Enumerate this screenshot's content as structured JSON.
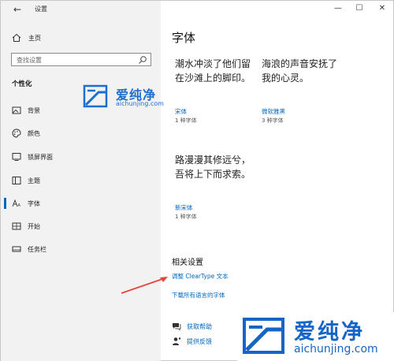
{
  "window": {
    "title": "设置"
  },
  "sidebar": {
    "home_label": "主页",
    "search_placeholder": "查找设置",
    "section_title": "个性化",
    "items": [
      {
        "label": "背景",
        "icon": "image-icon"
      },
      {
        "label": "颜色",
        "icon": "palette-icon"
      },
      {
        "label": "锁屏界面",
        "icon": "lock-screen-icon"
      },
      {
        "label": "主题",
        "icon": "theme-icon"
      },
      {
        "label": "字体",
        "icon": "font-icon",
        "active": true
      },
      {
        "label": "开始",
        "icon": "start-icon"
      },
      {
        "label": "任务栏",
        "icon": "taskbar-icon"
      }
    ]
  },
  "main": {
    "title": "字体",
    "fonts": [
      {
        "sample": "潮水冲淡了他们留在沙滩上的脚印。",
        "name": "宋体",
        "count": "1 种字体"
      },
      {
        "sample": "海浪的声音安抚了我的心灵。",
        "name": "微软雅黑",
        "count": "3 种字体"
      },
      {
        "sample": "路漫漫其修远兮，吾将上下而求索。",
        "name": "新宋体",
        "count": "1 种字体"
      }
    ],
    "related": {
      "title": "相关设置",
      "links": [
        "调整 ClearType 文本",
        "下载所有语言的字体"
      ]
    },
    "help": {
      "get_help": "获取帮助",
      "feedback": "提供反馈"
    }
  },
  "watermark": {
    "cn": "爱纯净",
    "en": "aichunjing.com"
  },
  "colors": {
    "accent": "#0067c0",
    "sidebar_bg": "#f2f2f2",
    "arrow": "#e8453c"
  }
}
